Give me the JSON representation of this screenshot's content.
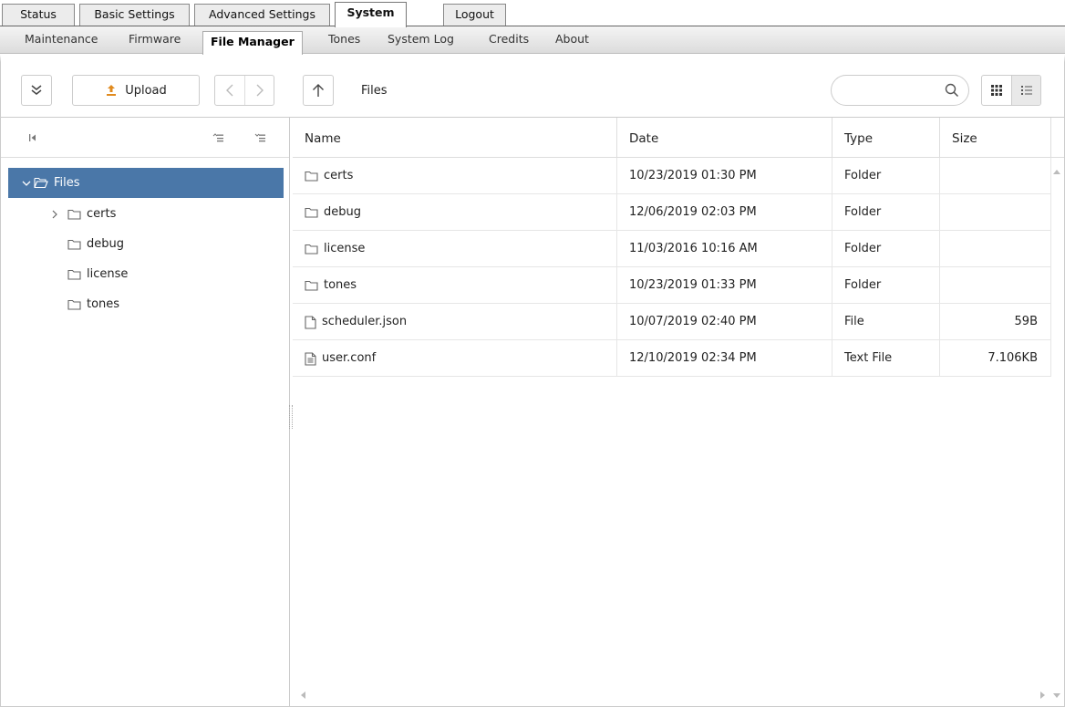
{
  "top_tabs": [
    "Status",
    "Basic Settings",
    "Advanced Settings",
    "System",
    "Logout"
  ],
  "active_top_tab": "System",
  "sub_tabs": [
    "Maintenance",
    "Firmware",
    "File Manager",
    "Tones",
    "System Log",
    "Credits",
    "About"
  ],
  "active_sub_tab": "File Manager",
  "toolbar": {
    "upload_label": "Upload",
    "current_path": "Files",
    "search_value": ""
  },
  "tree": {
    "root": "Files",
    "items": [
      "certs",
      "debug",
      "license",
      "tones"
    ]
  },
  "grid": {
    "columns": [
      "Name",
      "Date",
      "Type",
      "Size"
    ],
    "rows": [
      {
        "name": "certs",
        "date": "10/23/2019 01:30 PM",
        "type": "Folder",
        "size": "",
        "icon": "folder-icon"
      },
      {
        "name": "debug",
        "date": "12/06/2019 02:03 PM",
        "type": "Folder",
        "size": "",
        "icon": "folder-icon"
      },
      {
        "name": "license",
        "date": "11/03/2016 10:16 AM",
        "type": "Folder",
        "size": "",
        "icon": "folder-icon"
      },
      {
        "name": "tones",
        "date": "10/23/2019 01:33 PM",
        "type": "Folder",
        "size": "",
        "icon": "folder-icon"
      },
      {
        "name": "scheduler.json",
        "date": "10/07/2019 02:40 PM",
        "type": "File",
        "size": "59B",
        "icon": "file-icon"
      },
      {
        "name": "user.conf",
        "date": "12/10/2019 02:34 PM",
        "type": "Text File",
        "size": "7.106KB",
        "icon": "text-file-icon"
      }
    ]
  },
  "colors": {
    "selected_tree_bg": "#4a77a8",
    "border": "#cccccc",
    "icon_gray": "#555555"
  }
}
